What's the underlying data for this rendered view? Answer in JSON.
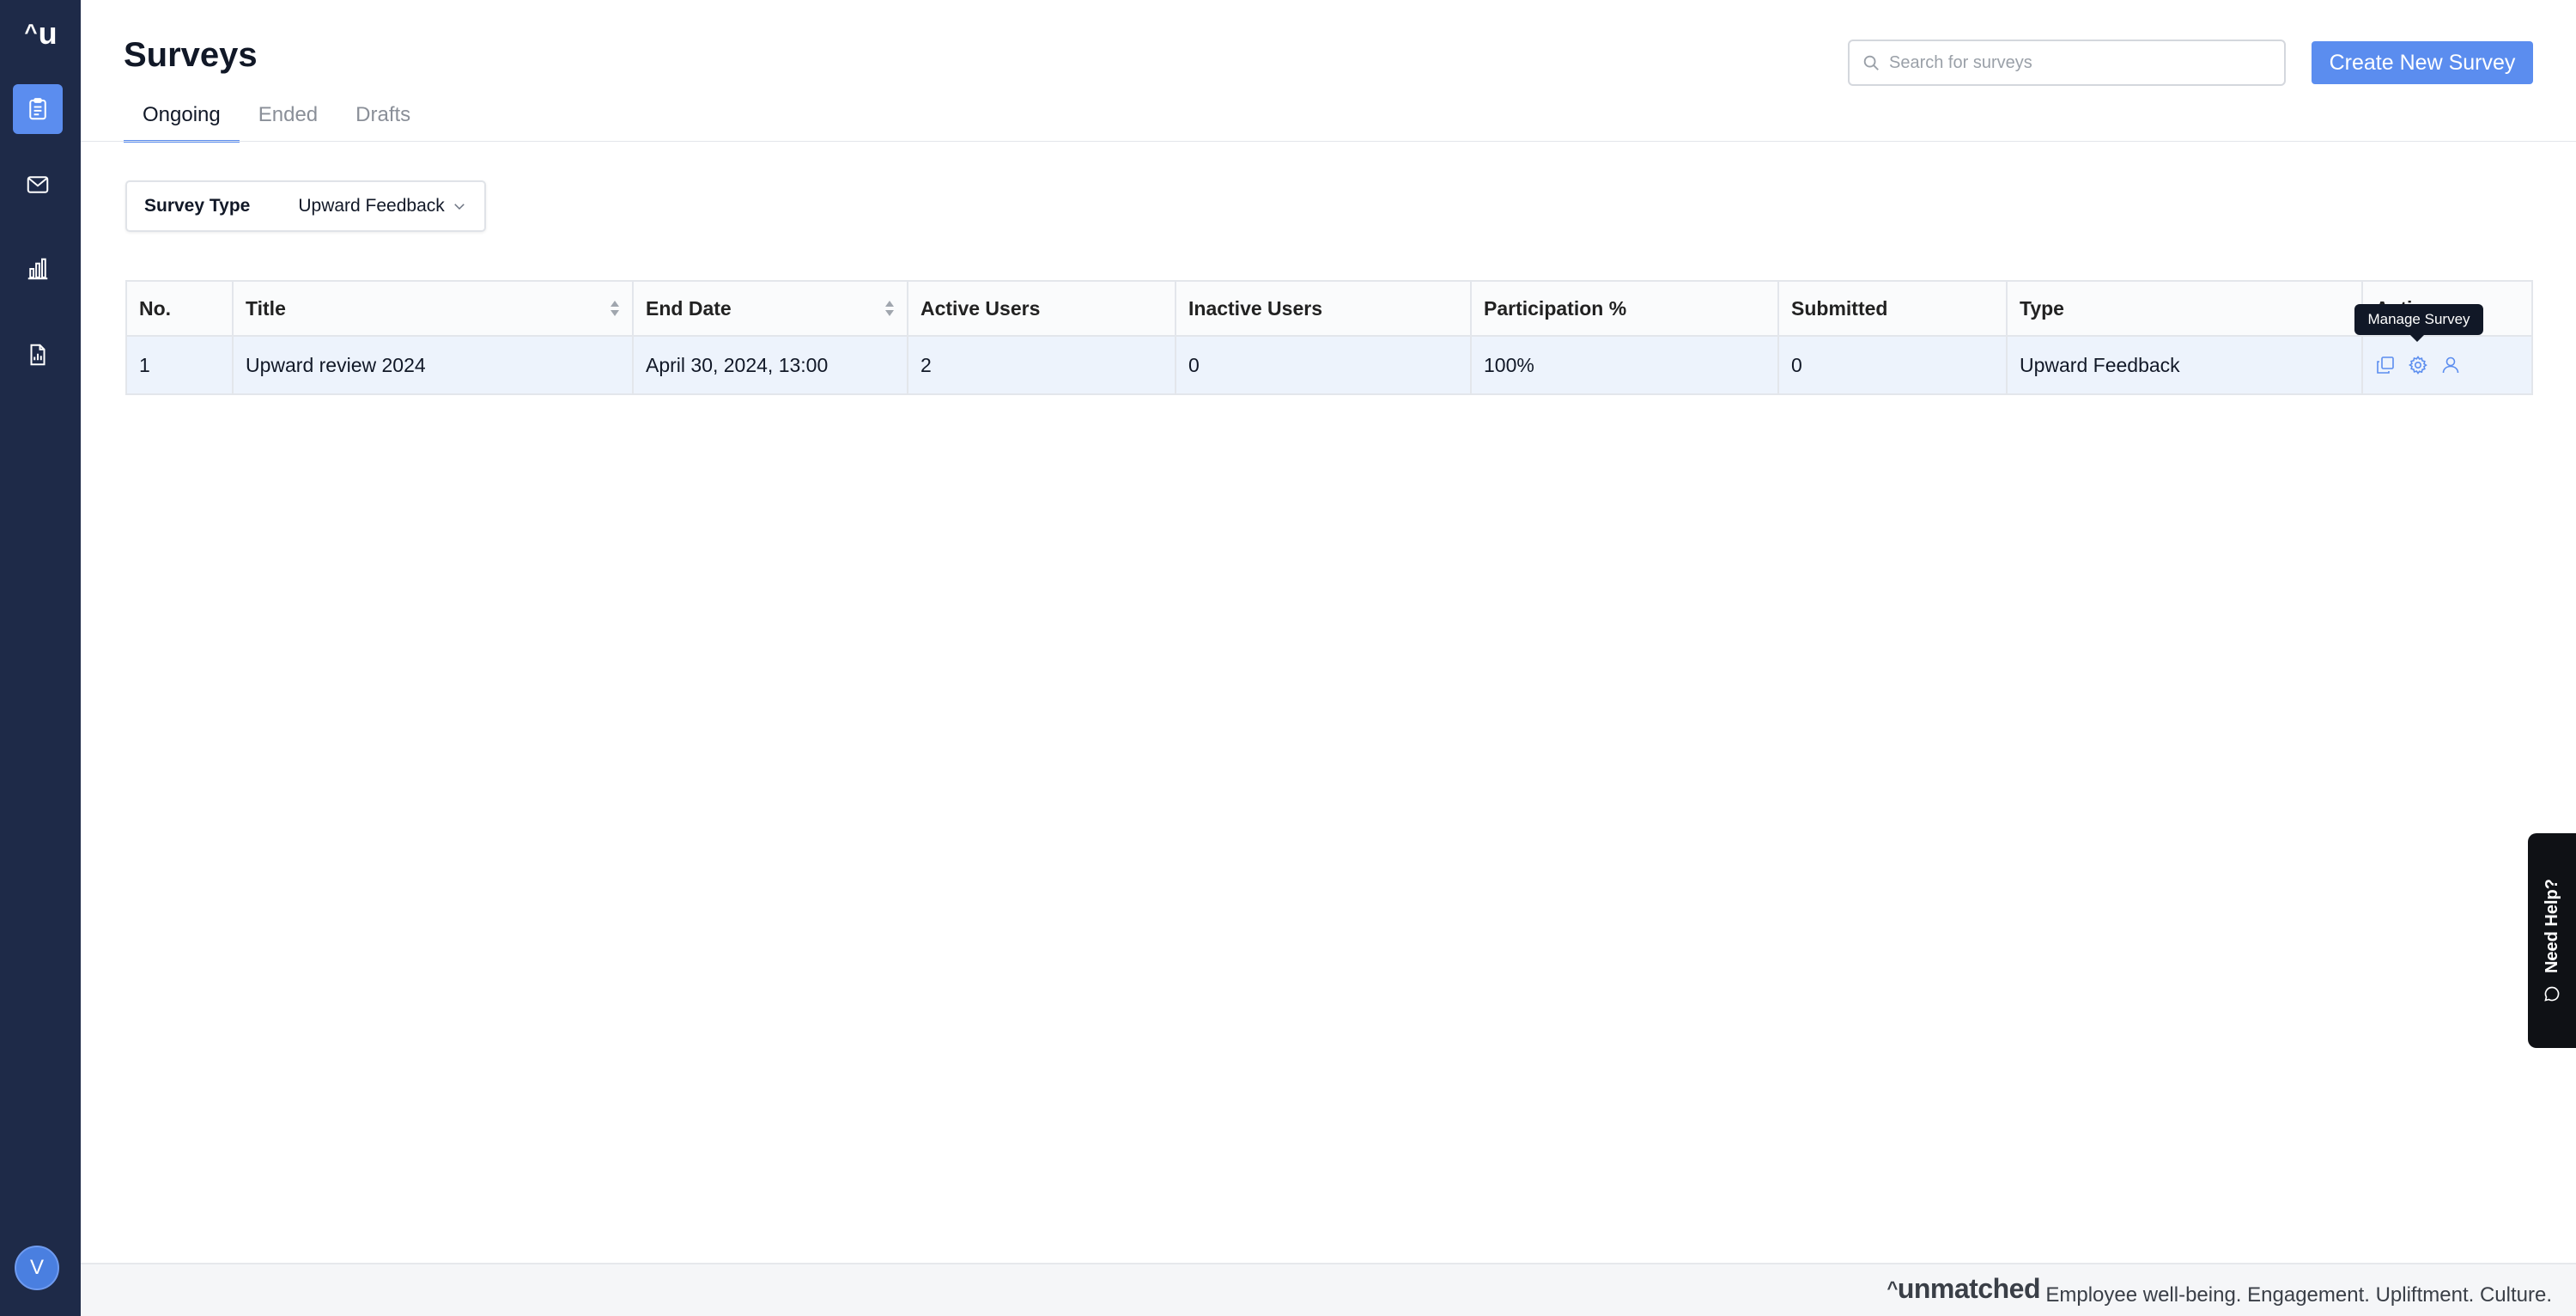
{
  "app": {
    "logo_text": "u",
    "logo_caret": "^",
    "avatar_initial": "V"
  },
  "sidebar": {
    "items": [
      {
        "icon": "clipboard-icon",
        "active": true
      },
      {
        "icon": "mail-icon",
        "active": false
      },
      {
        "icon": "bar-chart-icon",
        "active": false
      },
      {
        "icon": "report-icon",
        "active": false
      }
    ]
  },
  "header": {
    "title": "Surveys",
    "tabs": [
      {
        "label": "Ongoing",
        "active": true
      },
      {
        "label": "Ended",
        "active": false
      },
      {
        "label": "Drafts",
        "active": false
      }
    ],
    "search_placeholder": "Search for surveys",
    "search_value": "",
    "create_button": "Create New Survey"
  },
  "filter": {
    "label": "Survey Type",
    "value": "Upward Feedback"
  },
  "table": {
    "columns": [
      "No.",
      "Title",
      "End Date",
      "Active Users",
      "Inactive Users",
      "Participation %",
      "Submitted",
      "Type",
      "Actions"
    ],
    "rows": [
      {
        "no": "1",
        "title": "Upward review 2024",
        "end_date": "April 30, 2024, 13:00",
        "active_users": "2",
        "inactive_users": "0",
        "participation": "100%",
        "submitted": "0",
        "type": "Upward Feedback",
        "actions": [
          "copy-icon",
          "gear-icon",
          "user-icon"
        ]
      }
    ]
  },
  "tooltip": "Manage Survey",
  "need_help": "Need Help?",
  "footer": {
    "brand": "unmatched",
    "brand_caret": "^",
    "tagline": "Employee well-being. Engagement. Upliftment. Culture."
  },
  "colors": {
    "sidebar_bg": "#1e2a48",
    "accent": "#5b8def",
    "row_highlight": "#edf3fc"
  }
}
